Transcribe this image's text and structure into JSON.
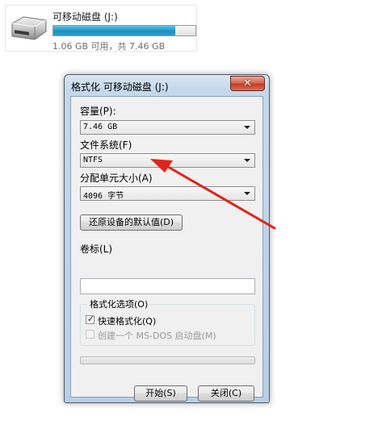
{
  "drive": {
    "name": "可移动磁盘 (J:)",
    "space_text": "1.06 GB 可用，共 7.46 GB",
    "used_fraction": 0.858
  },
  "dialog": {
    "title": "格式化 可移动磁盘 (J:)",
    "close_glyph": "✕",
    "capacity": {
      "label": "容量(P):",
      "value": "7.46 GB"
    },
    "filesystem": {
      "label": "文件系统(F)",
      "value": "NTFS"
    },
    "allocation": {
      "label": "分配单元大小(A)",
      "value": "4096 字节"
    },
    "restore_defaults_label": "还原设备的默认值(D)",
    "volume_label": {
      "label": "卷标(L)",
      "value": ""
    },
    "format_options": {
      "title": "格式化选项(O)",
      "quick_format": {
        "label": "快速格式化(Q)",
        "checked": true
      },
      "msdos_boot": {
        "label": "创建一个 MS-DOS 启动盘(M)",
        "checked": false,
        "enabled": false
      }
    },
    "progress_fraction": 0,
    "start_label": "开始(S)",
    "close_label": "关闭(C)"
  },
  "colors": {
    "annotation_arrow": "#e0241b",
    "drive_bar": "#1f8fc0"
  }
}
